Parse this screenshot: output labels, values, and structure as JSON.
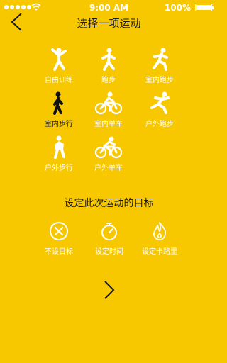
{
  "status_bar": {
    "time": "9:00 AM",
    "battery": "100%"
  },
  "header": {
    "title": "选择一项运动"
  },
  "sports": [
    {
      "label": "自由训练",
      "icon": "free-training-icon",
      "selected": false
    },
    {
      "label": "跑步",
      "icon": "run-icon",
      "selected": false
    },
    {
      "label": "室内跑步",
      "icon": "indoor-run-icon",
      "selected": false
    },
    {
      "label": "室内步行",
      "icon": "indoor-walk-icon",
      "selected": true
    },
    {
      "label": "室内单车",
      "icon": "indoor-bike-icon",
      "selected": false
    },
    {
      "label": "户外跑步",
      "icon": "outdoor-run-icon",
      "selected": false
    },
    {
      "label": "户外步行",
      "icon": "outdoor-walk-icon",
      "selected": false
    },
    {
      "label": "户外单车",
      "icon": "outdoor-bike-icon",
      "selected": false
    }
  ],
  "goal_section": {
    "title": "设定此次运动的目标",
    "options": [
      {
        "label": "不设目标",
        "icon": "no-goal-icon"
      },
      {
        "label": "设定时间",
        "icon": "stopwatch-icon"
      },
      {
        "label": "设定卡路里",
        "icon": "flame-icon"
      }
    ]
  },
  "colors": {
    "background": "#F7C700",
    "selected_text": "#1a1a1a",
    "icon": "#ffffff"
  }
}
